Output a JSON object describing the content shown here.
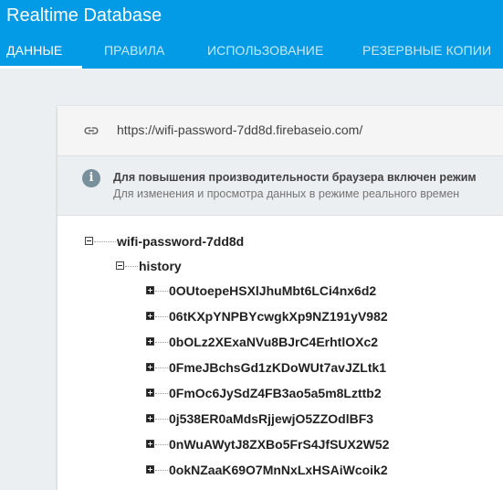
{
  "app": {
    "title": "Realtime Database"
  },
  "tabs": [
    {
      "label": "ДАННЫЕ",
      "active": true
    },
    {
      "label": "ПРАВИЛА",
      "active": false
    },
    {
      "label": "ИСПОЛЬЗОВАНИЕ",
      "active": false
    },
    {
      "label": "РЕЗЕРВНЫЕ КОПИИ",
      "active": false
    }
  ],
  "url_bar": {
    "icon": "link-icon",
    "url": "https://wifi-password-7dd8d.firebaseio.com/"
  },
  "info_banner": {
    "icon": "info-icon",
    "line1": "Для повышения производительности браузера включен режим",
    "line2": "Для изменения и просмотра данных в режиме реального времен"
  },
  "tree": {
    "root": "wifi-password-7dd8d",
    "child": "history",
    "items": [
      "0OUtoepeHSXlJhuMbt6LCi4nx6d2",
      "06tKXpYNPBYcwgkXp9NZ191yV982",
      "0bOLz2XExaNVu8BJrC4ErhtlOXc2",
      "0FmeJBchsGd1zKDoWUt7avJZLtk1",
      "0FmOc6JySdZ4FB3ao5a5m8Lzttb2",
      "0j538ER0aMdsRjjewjO5ZZOdlBF3",
      "0nWuAWytJ8ZXBo5FrS4JfSUX2W52",
      "0okNZaaK69O7MnNxLxHSAiWcoik2"
    ]
  },
  "colors": {
    "brand": "#039be5",
    "background": "#eceff1"
  }
}
